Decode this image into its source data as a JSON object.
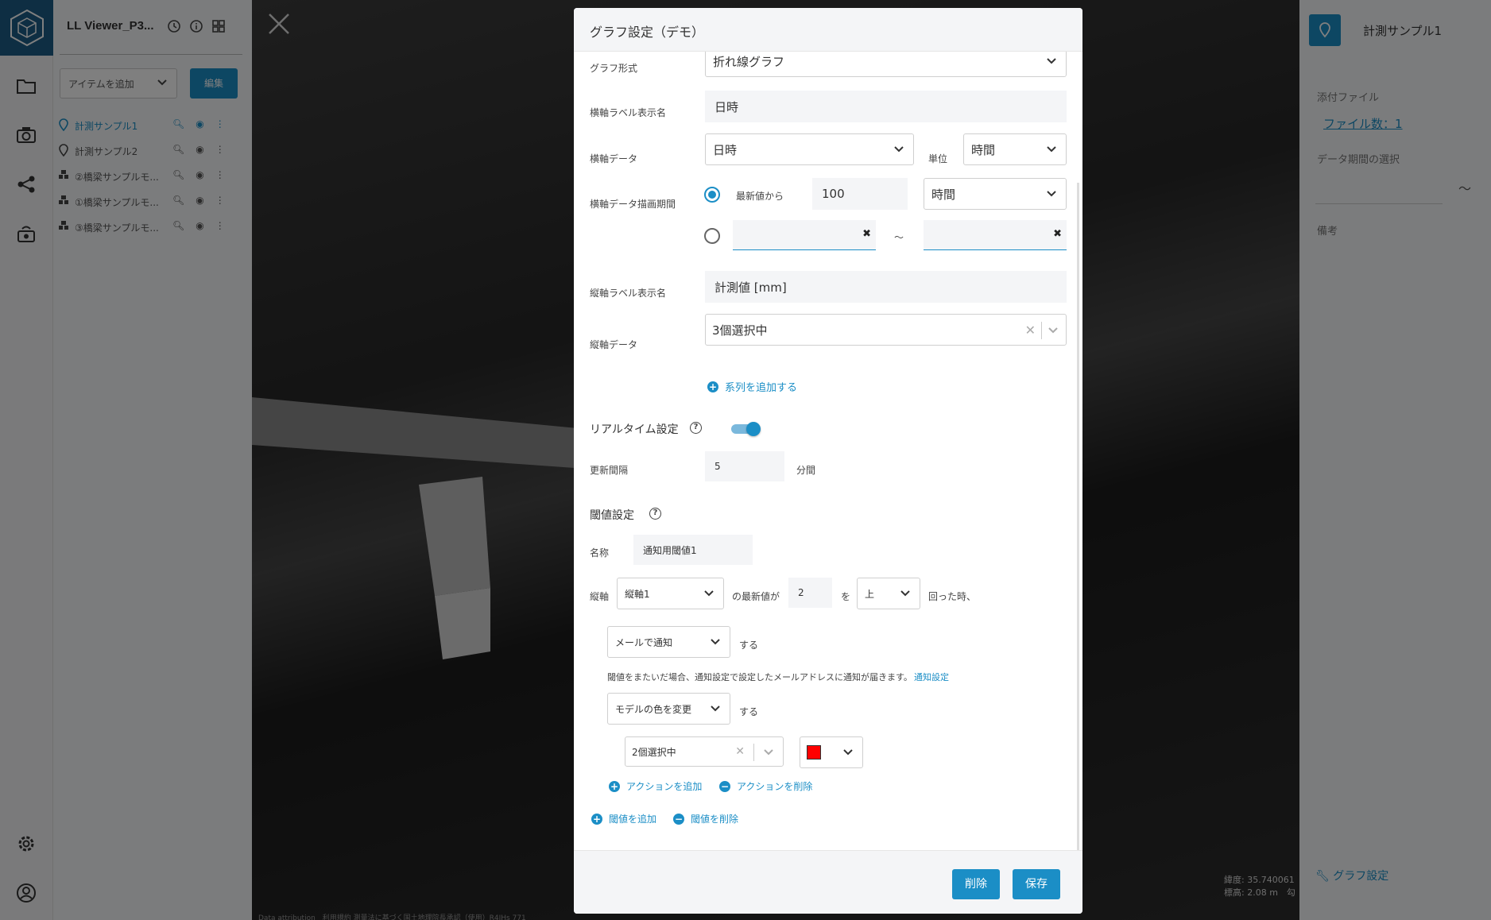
{
  "app": {
    "title": "LL Viewer_P3..."
  },
  "sidebar": {
    "add_item_label": "アイテムを追加",
    "edit_label": "編集",
    "items": [
      {
        "label": "計測サンプル1",
        "icon": "pin-icon",
        "active": true
      },
      {
        "label": "計測サンプル2",
        "icon": "pin-icon",
        "active": false
      },
      {
        "label": "②橋梁サンプルモ...",
        "icon": "cubes-icon",
        "active": false
      },
      {
        "label": "①橋梁サンプルモ...",
        "icon": "cubes-icon",
        "active": false
      },
      {
        "label": "③橋梁サンプルモ...",
        "icon": "cubes-icon",
        "active": false
      }
    ]
  },
  "right_panel": {
    "title": "計測サンプル1",
    "attachments_label": "添付ファイル",
    "file_count": "ファイル数：1",
    "period_label": "データ期間の選択",
    "period_sep": "〜",
    "notes_label": "備考",
    "graph_settings": "グラフ設定"
  },
  "map": {
    "coords_lat": "緯度: 35.740061",
    "coords_alt": "標高: 2.08 m　勾",
    "attribution": "Data attribution　利用規約 測量法に基づく国土地理院長承認（使用）R4JHs 771"
  },
  "modal": {
    "title": "グラフ設定（デモ）",
    "graph_type_label": "グラフ形式",
    "graph_type_value": "折れ線グラフ",
    "x_label_label": "横軸ラベル表示名",
    "x_label_value": "日時",
    "x_data_label": "横軸データ",
    "x_data_value": "日時",
    "unit_label": "単位",
    "unit_value": "時間",
    "x_period_label": "横軸データ描画期間",
    "from_latest_label": "最新値から",
    "from_latest_value": "100",
    "period_unit_value": "時間",
    "range_sep": "〜",
    "y_label_label": "縦軸ラベル表示名",
    "y_label_value": "計測値 [mm]",
    "y_data_label": "縦軸データ",
    "y_data_value": "3個選択中",
    "add_series": "系列を追加する",
    "realtime_label": "リアルタイム設定",
    "realtime_on": true,
    "interval_label": "更新間隔",
    "interval_value": "5",
    "interval_unit": "分間",
    "threshold_label": "閾値設定",
    "name_label": "名称",
    "name_value": "通知用閾値1",
    "axis_label": "縦軸",
    "axis_value": "縦軸1",
    "latest_text": "の最新値が",
    "threshold_value": "2",
    "wo_text": "を",
    "direction_value": "上",
    "crossed_text": "回った時、",
    "action1_value": "メールで通知",
    "suru1": "する",
    "mail_note": "閾値をまたいだ場合、通知設定で設定したメールアドレスに通知が届きます。",
    "notify_settings_link": "通知設定",
    "action2_value": "モデルの色を変更",
    "suru2": "する",
    "models_value": "2個選択中",
    "color_value": "#ff0000",
    "add_action": "アクションを追加",
    "remove_action": "アクションを削除",
    "add_threshold": "閾値を追加",
    "remove_threshold": "閾値を削除",
    "delete_btn": "削除",
    "save_btn": "保存"
  }
}
